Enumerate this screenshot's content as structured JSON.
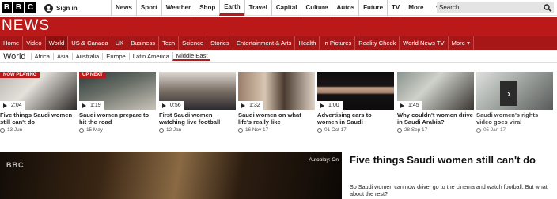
{
  "brand": {
    "logo_letters": [
      "B",
      "B",
      "C"
    ],
    "accent": "#bb1919"
  },
  "topbar": {
    "signin": "Sign in",
    "nav": [
      "News",
      "Sport",
      "Weather",
      "Shop",
      "Earth",
      "Travel",
      "Capital",
      "Culture",
      "Autos",
      "Future",
      "TV",
      "More"
    ],
    "active": "Earth",
    "search_placeholder": "Search"
  },
  "masthead": {
    "title": "NEWS"
  },
  "subnav": {
    "items": [
      "Home",
      "Video",
      "World",
      "US & Canada",
      "UK",
      "Business",
      "Tech",
      "Science",
      "Stories",
      "Entertainment & Arts",
      "Health",
      "In Pictures",
      "Reality Check",
      "World News TV",
      "More"
    ],
    "active": "World"
  },
  "section": {
    "home": "World",
    "regions": [
      "Africa",
      "Asia",
      "Australia",
      "Europe",
      "Latin America",
      "Middle East"
    ],
    "active": "Middle East"
  },
  "videos": [
    {
      "badge": "NOW PLAYING",
      "duration": "2:04",
      "title": "Five things Saudi women still can't do",
      "date": "13 Jun"
    },
    {
      "badge": "UP NEXT",
      "duration": "1:19",
      "title": "Saudi women prepare to hit the road",
      "date": "15 May"
    },
    {
      "badge": "",
      "duration": "0:56",
      "title": "First Saudi women watching live football",
      "date": "12 Jan"
    },
    {
      "badge": "",
      "duration": "1:32",
      "title": "Saudi women on what life's really like",
      "date": "16 Nov 17"
    },
    {
      "badge": "",
      "duration": "1:00",
      "title": "Advertising cars to women in Saudi",
      "date": "01 Oct 17"
    },
    {
      "badge": "",
      "duration": "1:45",
      "title": "Why couldn't women drive in Saudi Arabia?",
      "date": "28 Sep 17"
    },
    {
      "badge": "",
      "duration": "",
      "title": "Saudi women's rights video goes viral",
      "date": "05 Jan 17"
    }
  ],
  "player": {
    "watermark": "BBC",
    "autoplay": "Autoplay: On"
  },
  "feature": {
    "title": "Five things Saudi women still can't do",
    "summary": "So Saudi women can now drive, go to the cinema and watch football. But what about the rest?"
  }
}
